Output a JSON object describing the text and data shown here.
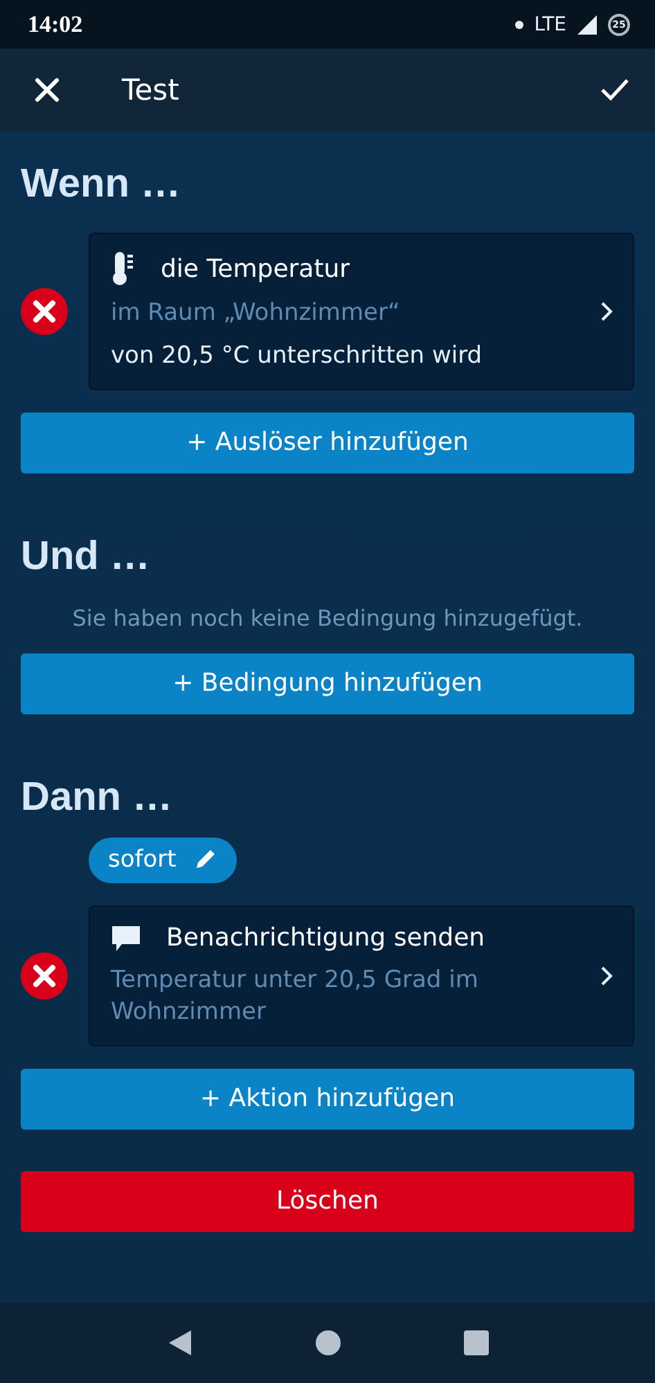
{
  "status_bar": {
    "time": "14:02",
    "network": "LTE",
    "badge": "25"
  },
  "app_bar": {
    "title": "Test"
  },
  "sections": [
    {
      "heading": "Wenn …",
      "cards": [
        {
          "kind": "trigger",
          "title": "die Temperatur",
          "lines": [
            {
              "text": "im Raum „Wohnzimmer“",
              "kind": "muted"
            },
            {
              "text": "von 20,5 °C unterschritten wird",
              "kind": "normal"
            }
          ]
        }
      ],
      "add_button": "+ Auslöser hinzufügen"
    },
    {
      "heading": "Und …",
      "empty_message": "Sie haben noch keine Bedingung hinzugefügt.",
      "add_button": "+ Bedingung hinzufügen"
    },
    {
      "heading": "Dann …",
      "chip": "sofort",
      "cards": [
        {
          "kind": "action",
          "title": "Benachrichtigung senden",
          "lines": [
            {
              "text": "Temperatur unter 20,5 Grad im Wohnzimmer",
              "kind": "muted"
            }
          ]
        }
      ],
      "add_button": "+ Aktion hinzufügen"
    }
  ],
  "delete_button": "Löschen"
}
